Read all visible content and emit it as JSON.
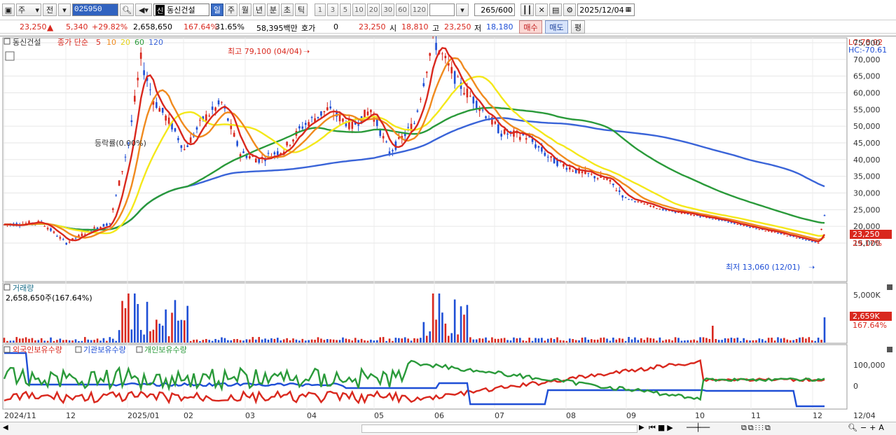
{
  "toolbar": {
    "market_label": "주",
    "prev_label": "전",
    "stock_code": "025950",
    "stock_badge": "신",
    "stock_name": "동신건설",
    "periods": [
      "일",
      "주",
      "월",
      "년",
      "분",
      "초",
      "틱"
    ],
    "selected_period": "일",
    "intervals": [
      "1",
      "3",
      "5",
      "10",
      "20",
      "30",
      "60",
      "120"
    ],
    "count": "265",
    "count_max": "/600",
    "date": "2025/12/04"
  },
  "quote": {
    "price": "23,250",
    "change": "5,340",
    "change_pct": "+29.82%",
    "volume": "2,658,650",
    "volume_ratio": "167.64%",
    "turnover": "31.65%",
    "amount": "58,395백만",
    "hoga_label": "호가",
    "hoga_value": "0",
    "hoga_price": "23,250",
    "open_label": "시",
    "open": "18,810",
    "high_label": "고",
    "high": "23,250",
    "low_label": "저",
    "low": "18,180",
    "buy_label": "매수",
    "sell_label": "매도",
    "avg_label": "평"
  },
  "price_panel": {
    "stock_name": "동신건설",
    "legend_prefix": "종가 단순",
    "ma_labels": [
      "5",
      "10",
      "20",
      "60",
      "120"
    ],
    "lc": "LC:78.02",
    "hc": "HC:-70.61",
    "high_annotation": "최고 79,100 (04/04)",
    "low_annotation": "최저 13,060 (12/01)",
    "mid_annotation": "등락률(0.00%)",
    "price_tag": "23,250",
    "pct_tag": "29.17%",
    "y_ticks": [
      "75,000",
      "70,000",
      "65,000",
      "60,000",
      "55,000",
      "50,000",
      "45,000",
      "40,000",
      "35,000",
      "30,000",
      "25,000",
      "20,000",
      "15,000"
    ]
  },
  "volume_panel": {
    "title": "거래량",
    "subtitle": "2,658,650주(167.64%)",
    "y_tick": "5,000K",
    "value_tag": "2,659K",
    "pct_tag": "167.64%"
  },
  "holdings_panel": {
    "foreign_label": "외국인보유수량",
    "institution_label": "기관보유수량",
    "individual_label": "개인보유수량",
    "y_ticks": [
      "100,000",
      "0"
    ]
  },
  "x_axis": {
    "labels": [
      "2024/11",
      "12",
      "2025/01",
      "02",
      "03",
      "04",
      "05",
      "06",
      "07",
      "08",
      "09",
      "10",
      "11",
      "12",
      "12/04"
    ]
  },
  "colors": {
    "up": "#d9281e",
    "down": "#1f4fd6",
    "ma5": "#d9281e",
    "ma10": "#f08a1e",
    "ma20": "#f4e81a",
    "ma60": "#2a9a3a",
    "ma120": "#3a64d8"
  }
}
